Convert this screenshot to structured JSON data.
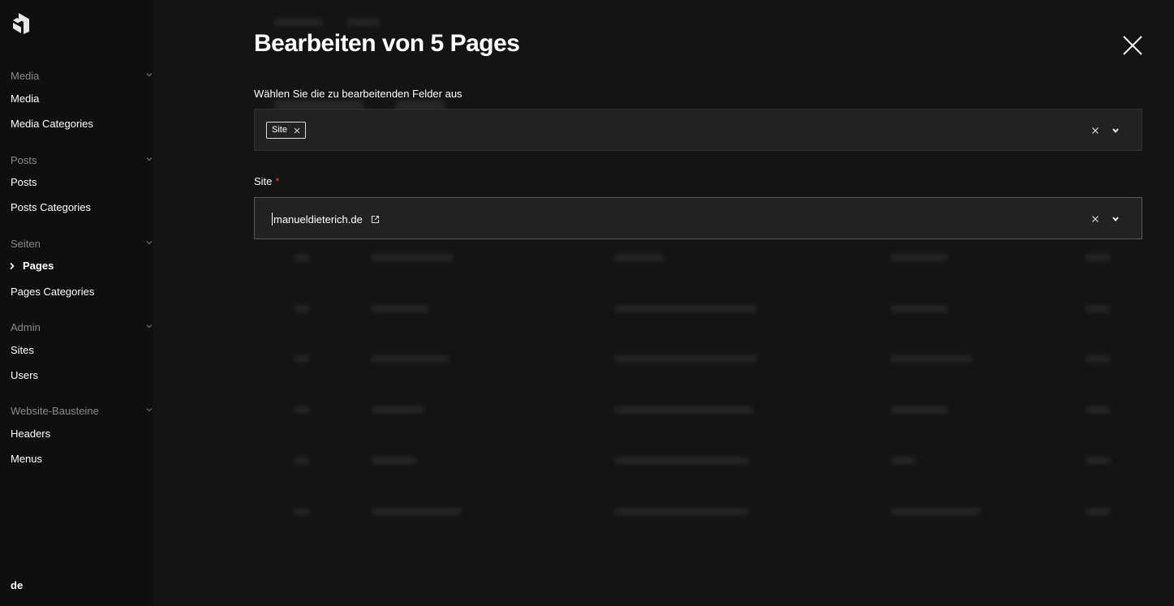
{
  "sidebar": {
    "groups": [
      {
        "title": "Media",
        "items": [
          "Media",
          "Media Categories"
        ]
      },
      {
        "title": "Posts",
        "items": [
          "Posts",
          "Posts Categories"
        ]
      },
      {
        "title": "Seiten",
        "items": [
          "Pages",
          "Pages Categories"
        ]
      },
      {
        "title": "Admin",
        "items": [
          "Sites",
          "Users"
        ]
      },
      {
        "title": "Website-Bausteine",
        "items": [
          "Headers",
          "Menus"
        ]
      }
    ],
    "active_item": "Pages",
    "language": "de"
  },
  "modal": {
    "title": "Bearbeiten von 5 Pages",
    "fields_label": "Wählen Sie die zu bearbeitenden Felder aus",
    "selected_fields": [
      {
        "label": "Site"
      }
    ],
    "site_label": "Site",
    "required_mark": "*",
    "site_value": "manueldieterich.de"
  },
  "colors": {
    "background": "#141414",
    "sidebar": "#0f0f0f",
    "input_bg": "#222222",
    "required": "#e0524a"
  },
  "icons": {
    "logo": "payload-logo",
    "close": "close-icon",
    "clear": "clear-icon",
    "dropdown": "chevron-down-icon",
    "external": "external-link-icon"
  }
}
